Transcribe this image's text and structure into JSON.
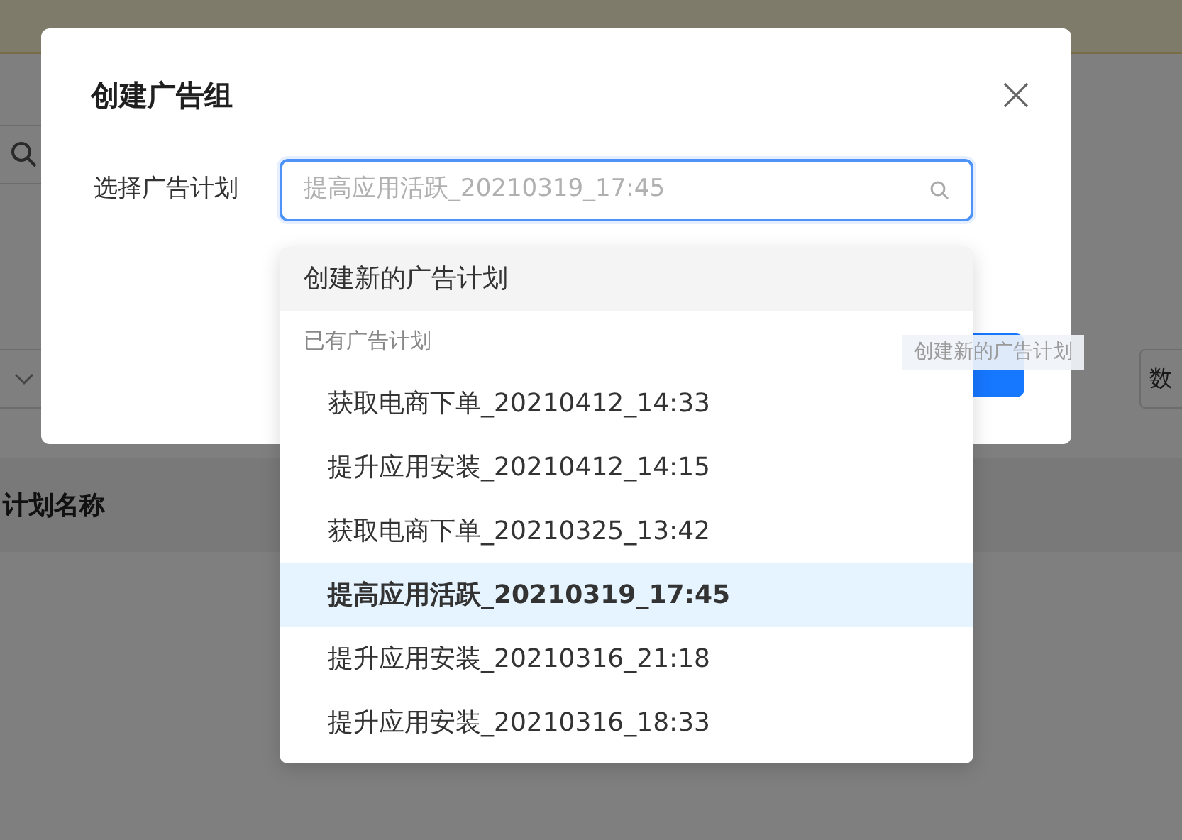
{
  "page": {
    "table": {
      "columns": [
        "计划名称"
      ]
    },
    "side_button": "数"
  },
  "dialog": {
    "title": "创建广告组",
    "field_label": "选择广告计划",
    "search": {
      "placeholder": "提高应用活跃_20210319_17:45"
    },
    "drag_ghost": "创建新的广告计划",
    "dropdown": {
      "create_option": "创建新的广告计划",
      "group_label": "已有广告计划",
      "options": [
        {
          "label": "获取电商下单_20210412_14:33",
          "selected": false
        },
        {
          "label": "提升应用安装_20210412_14:15",
          "selected": false
        },
        {
          "label": "获取电商下单_20210325_13:42",
          "selected": false
        },
        {
          "label": "提高应用活跃_20210319_17:45",
          "selected": true
        },
        {
          "label": "提升应用安装_20210316_21:18",
          "selected": false
        },
        {
          "label": "提升应用安装_20210316_18:33",
          "selected": false
        }
      ]
    }
  }
}
